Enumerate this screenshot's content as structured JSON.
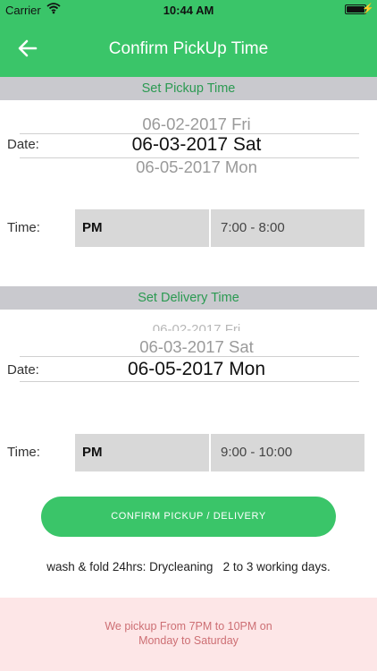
{
  "status_bar": {
    "carrier": "Carrier",
    "time": "10:44 AM"
  },
  "nav": {
    "title": "Confirm PickUp Time"
  },
  "pickup": {
    "header": "Set Pickup Time",
    "date_label": "Date:",
    "dates": {
      "prev": "06-02-2017 Fri",
      "selected": "06-03-2017 Sat",
      "next": "06-05-2017 Mon"
    },
    "time_label": "Time:",
    "ampm": "PM",
    "slot": "7:00 - 8:00"
  },
  "delivery": {
    "header": "Set Delivery Time",
    "date_label": "Date:",
    "dates": {
      "prev2": "06-02-2017 Fri",
      "prev": "06-03-2017 Sat",
      "selected": "06-05-2017 Mon"
    },
    "time_label": "Time:",
    "ampm": "PM",
    "slot": "9:00 - 10:00"
  },
  "confirm_button": "CONFIRM PICKUP / DELIVERY",
  "info_text": "wash & fold 24hrs: Drycleaning   2 to 3 working days.",
  "notice": {
    "line1": "We pickup From 7PM to 10PM on",
    "line2": "Monday to Saturday"
  },
  "colors": {
    "accent": "#3ac569",
    "header_bg": "#c9c9ce",
    "notice_bg": "#fde6e7",
    "notice_text": "#cd6f74"
  }
}
